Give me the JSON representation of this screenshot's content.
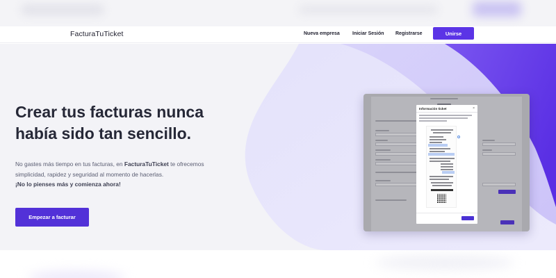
{
  "navbar": {
    "logo": "FacturaTuTicket",
    "links": [
      "Nueva empresa",
      "Iniciar Sesión",
      "Registrarse"
    ],
    "cta": "Unirse"
  },
  "hero": {
    "headline_line1": "Crear tus facturas nunca",
    "headline_line2": "había sido tan sencillo.",
    "desc_part1": "No gastes más tiempo en tus facturas, en ",
    "desc_brand": "FacturaTuTicket",
    "desc_part2": " te ofrecemos simplicidad, rapidez y seguridad al momento de hacerlas.",
    "desc_cta": "¡No lo pienses más y comienza ahora!",
    "button": "Empezar a facturar"
  },
  "preview": {
    "modal_title": "Información ticket",
    "close": "×"
  },
  "colors": {
    "accent": "#5b34e6",
    "button": "#5231d8",
    "headline": "#262837"
  }
}
